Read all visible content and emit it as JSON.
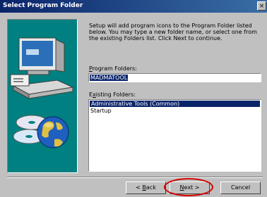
{
  "window": {
    "title": "Select Program Folder",
    "close_label": "×"
  },
  "description": "Setup will add program icons to the Program Folder listed below. You may type a new folder name, or select one from the existing Folders list.  Click Next to continue.",
  "program_folder": {
    "label_accel": "P",
    "label_rest": "rogram Folders:",
    "value": "MADMATOOL"
  },
  "existing_folders": {
    "label_first": "E",
    "label_accel": "x",
    "label_rest": "isting Folders:",
    "items": [
      "Administrative Tools (Common)",
      "Startup"
    ],
    "selected_index": 0
  },
  "buttons": {
    "back": {
      "prefix": "< ",
      "accel": "B",
      "rest": "ack"
    },
    "next": {
      "accel": "N",
      "rest": "ext >"
    },
    "cancel": "Cancel"
  },
  "annotation": {
    "highlight_color": "#d40000",
    "highlight_target": "next-button"
  },
  "colors": {
    "face": "#c0c0c0",
    "title_bar": "#0a246a",
    "art_background": "#008080",
    "selection": "#0a246a"
  },
  "icons": [
    "computer-icon",
    "cd-disc-icon",
    "globe-icon",
    "close-icon"
  ]
}
